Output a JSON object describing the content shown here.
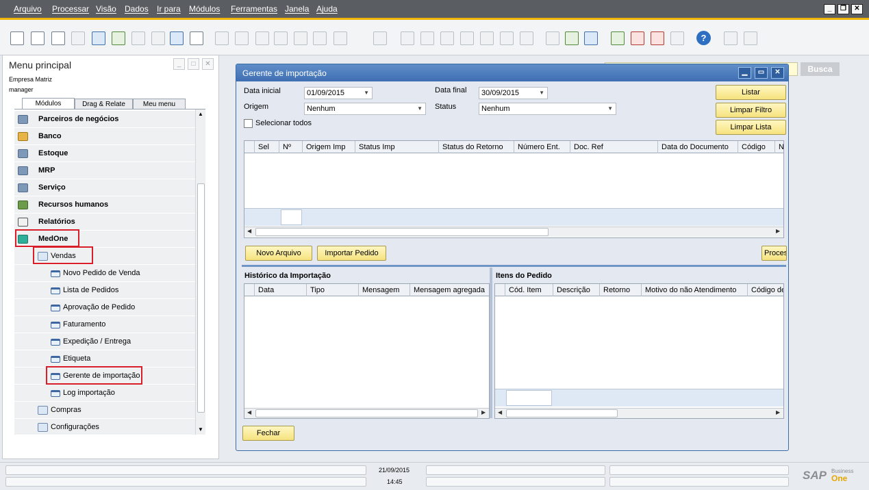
{
  "menubar": {
    "items": [
      "Arquivo",
      "Processar",
      "Visão",
      "Dados",
      "Ir para",
      "Módulos",
      "Ferramentas",
      "Janela",
      "Ajuda"
    ]
  },
  "toolbar": {
    "help_label": "?"
  },
  "left_panel": {
    "title": "Menu principal",
    "company": "Empresa Matriz",
    "user": "manager",
    "tabs": [
      "Módulos",
      "Drag & Relate",
      "Meu menu"
    ],
    "modules": [
      {
        "label": "Parceiros de negócios",
        "icon": "partners-icon"
      },
      {
        "label": "Banco",
        "icon": "bank-icon"
      },
      {
        "label": "Estoque",
        "icon": "inventory-icon"
      },
      {
        "label": "MRP",
        "icon": "mrp-icon"
      },
      {
        "label": "Serviço",
        "icon": "service-icon"
      },
      {
        "label": "Recursos humanos",
        "icon": "hr-icon"
      },
      {
        "label": "Relatórios",
        "icon": "reports-icon"
      },
      {
        "label": "MedOne",
        "icon": "medone-icon"
      }
    ],
    "vendas": {
      "label": "Vendas",
      "icon": "folder-open-icon"
    },
    "forms": [
      "Novo Pedido de Venda",
      "Lista de Pedidos",
      "Aprovação de Pedido",
      "Faturamento",
      "Expedição / Entrega",
      "Etiqueta",
      "Gerente de importação",
      "Log importação"
    ],
    "folders": [
      "Compras",
      "Configurações"
    ]
  },
  "search": {
    "button": "Busca"
  },
  "dialog": {
    "title": "Gerente de importação",
    "data_inicial_label": "Data inicial",
    "data_inicial": "01/09/2015",
    "data_final_label": "Data final",
    "data_final": "30/09/2015",
    "origem_label": "Origem",
    "origem": "Nenhum",
    "status_label": "Status",
    "status": "Nenhum",
    "select_all": "Selecionar todos",
    "listar": "Listar",
    "limpar_filtro": "Limpar Filtro",
    "limpar_lista": "Limpar Lista",
    "grid_columns": [
      "Sel",
      "Nº",
      "Origem Imp",
      "Status Imp",
      "Status do Retorno",
      "Número Ent.",
      "Doc. Ref",
      "Data do Documento",
      "Código",
      "N"
    ],
    "novo_arquivo": "Novo Arquivo",
    "importar_pedido": "Importar Pedido",
    "processar": "Proces",
    "historico_title": "Histórico da Importação",
    "historico_columns": [
      "Data",
      "Tipo",
      "Mensagem",
      "Mensagem agregada"
    ],
    "itens_title": "Itens do Pedido",
    "itens_columns": [
      "Cód. Item",
      "Descrição",
      "Retorno",
      "Motivo do não Atendimento",
      "Código de"
    ],
    "fechar": "Fechar"
  },
  "statusbar": {
    "date": "21/09/2015",
    "time": "14:45",
    "logo_sap": "SAP",
    "logo_business": "Business",
    "logo_one": "One"
  }
}
